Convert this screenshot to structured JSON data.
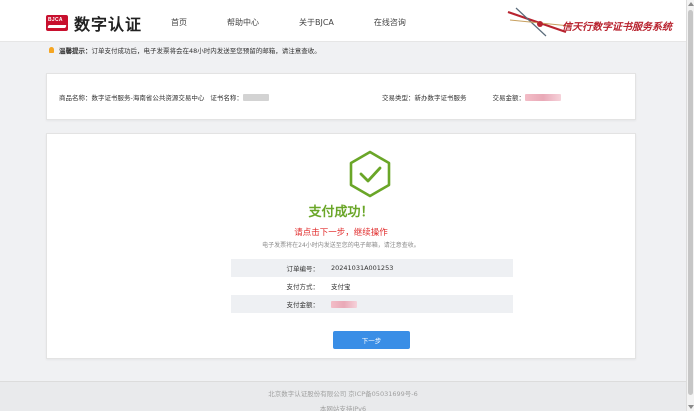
{
  "header": {
    "logo_text": "数字认证",
    "logo_mark": "BJCA",
    "nav": [
      "首页",
      "帮助中心",
      "关于BJCA",
      "在线咨询"
    ],
    "brand_text": "信天行数字证书服务系统"
  },
  "notice": {
    "label": "温馨提示：",
    "message": "订单支付成功后，电子发票将会在48小时内发送至您预留的邮箱，请注意查收。"
  },
  "info": {
    "product_label": "商品名称：",
    "product_value": "数字证书服务-海南省公共资源交易中心",
    "cert_label": "证书名称：",
    "type_label": "交易类型：",
    "type_value": "新办数字证书服务",
    "amount_label": "交易金额："
  },
  "success": {
    "title": "支付成功！",
    "next_hint": "请点击下一步，继续操作",
    "sub": "电子发票将在24小时内发送至您的电子邮箱，请注意查收。",
    "order": [
      {
        "label": "订单编号：",
        "value": "20241031A001253"
      },
      {
        "label": "支付方式：",
        "value": "支付宝"
      },
      {
        "label": "支付金额：",
        "value": ""
      }
    ],
    "next_button": "下一步"
  },
  "footer": {
    "line1": "北京数字认证股份有限公司 京ICP备05031699号-6",
    "line2": "本网站支持IPv6"
  },
  "colors": {
    "success_green": "#6aa628",
    "next_hint_red": "#e12b2b",
    "button_blue": "#3a8ee6",
    "brand_red": "#b8232f"
  },
  "icons": {
    "check": "hexagon-check-icon",
    "bulb": "lightbulb-icon"
  }
}
